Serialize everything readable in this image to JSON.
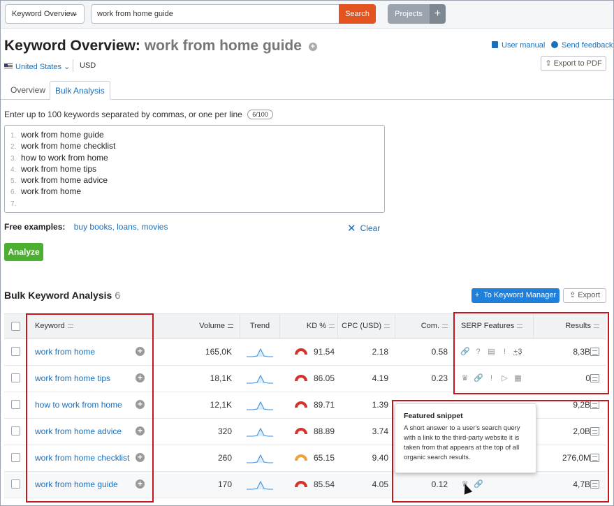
{
  "topbar": {
    "database_label": "Keyword Overview",
    "search_value": "work from home guide",
    "search_button": "Search",
    "projects_button": "Projects",
    "projects_plus": "+"
  },
  "header": {
    "title_prefix": "Keyword Overview:",
    "title_keyword": "work from home guide",
    "user_manual": "User manual",
    "send_feedback": "Send feedback",
    "export_pdf": "Export to PDF",
    "region": "United States",
    "currency": "USD"
  },
  "tabs": [
    {
      "label": "Overview"
    },
    {
      "label": "Bulk Analysis"
    }
  ],
  "bulk_input": {
    "instruction": "Enter up to 100 keywords separated by commas, or one per line",
    "counter": "6/100",
    "lines": [
      {
        "n": "1.",
        "text": "work from home guide"
      },
      {
        "n": "2.",
        "text": "work from home checklist"
      },
      {
        "n": "3.",
        "text": "how to work from home"
      },
      {
        "n": "4.",
        "text": "work from home tips"
      },
      {
        "n": "5.",
        "text": "work from home advice"
      },
      {
        "n": "6.",
        "text": "work from home"
      },
      {
        "n": "7.",
        "text": ""
      }
    ],
    "free_label": "Free examples:",
    "free_examples": "buy books, loans, movies",
    "clear": "Clear",
    "analyze": "Analyze"
  },
  "analysis": {
    "title": "Bulk Keyword Analysis",
    "count": "6",
    "to_keyword_manager": "To Keyword Manager",
    "export": "Export",
    "columns": {
      "keyword": "Keyword",
      "volume": "Volume",
      "trend": "Trend",
      "kd": "KD %",
      "cpc": "CPC (USD)",
      "com": "Com.",
      "serp": "SERP Features",
      "results": "Results"
    },
    "rows": [
      {
        "keyword": "work from home",
        "volume": "165,0K",
        "kd": "91.54",
        "kd_color": "#d6312b",
        "cpc": "2.18",
        "com": "0.58",
        "serp_more": "+3",
        "results": "8,3B"
      },
      {
        "keyword": "work from home tips",
        "volume": "18,1K",
        "kd": "86.05",
        "kd_color": "#d6312b",
        "cpc": "4.19",
        "com": "0.23",
        "serp_more": "",
        "results": "0"
      },
      {
        "keyword": "how to work from home",
        "volume": "12,1K",
        "kd": "89.71",
        "kd_color": "#d6312b",
        "cpc": "1.39",
        "com": "",
        "serp_more": "",
        "results": "9,2B"
      },
      {
        "keyword": "work from home advice",
        "volume": "320",
        "kd": "88.89",
        "kd_color": "#d6312b",
        "cpc": "3.74",
        "com": "",
        "serp_more": "",
        "results": "2,0B"
      },
      {
        "keyword": "work from home checklist",
        "volume": "260",
        "kd": "65.15",
        "kd_color": "#f0a03c",
        "cpc": "9.40",
        "com": "",
        "serp_more": "",
        "results": "276,0M"
      },
      {
        "keyword": "work from home guide",
        "volume": "170",
        "kd": "85.54",
        "kd_color": "#d6312b",
        "cpc": "4.05",
        "com": "0.12",
        "serp_more": "",
        "results": "4,7B"
      }
    ]
  },
  "tooltip": {
    "title": "Featured snippet",
    "body": "A short answer to a user's search query with a link to the third-party website it is taken from that appears at the top of all organic search results."
  },
  "colors": {
    "search_button": "#e2531f",
    "primary_button": "#1e80dc",
    "analyze_button": "#4caf32",
    "highlight": "#c4161c",
    "link": "#1a6fba"
  }
}
